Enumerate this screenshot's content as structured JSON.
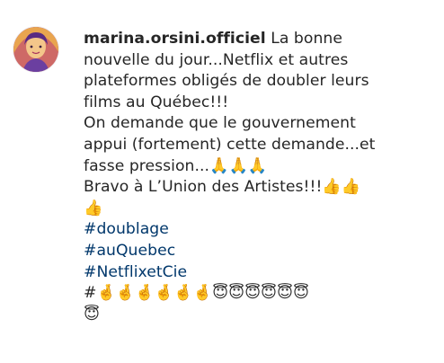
{
  "comment": {
    "username": "marina.orsini.officiel",
    "body_line1_rest": "La bonne",
    "body_line2": "nouvelle du jour...Netflix et autres",
    "body_line3": "plateformes obligés de doubler leurs",
    "body_line4": "films au Québec!!!",
    "body_line5": "On demande que le gouvernement",
    "body_line6": "appui (fortement) cette demande...et",
    "body_line7": "fasse pression...🙏🙏🙏",
    "body_line8": "Bravo à L’Union des Artistes!!!👍👍",
    "body_line9": "👍",
    "hashtags": [
      "#doublage",
      "#auQuebec",
      "#NetflixetCie"
    ],
    "last_line": "#🤞🤞🤞🤞🤞🤞😇😇😇😇😇😇",
    "last_line_wrap": "😇"
  },
  "avatar": {
    "icon": "profile-photo-avatar",
    "accent_colors": [
      "#f7d27a",
      "#e8a24c",
      "#b8397a",
      "#6b3fa0"
    ]
  },
  "colors": {
    "text": "#262626",
    "hashtag": "#00376b",
    "background": "#ffffff"
  }
}
